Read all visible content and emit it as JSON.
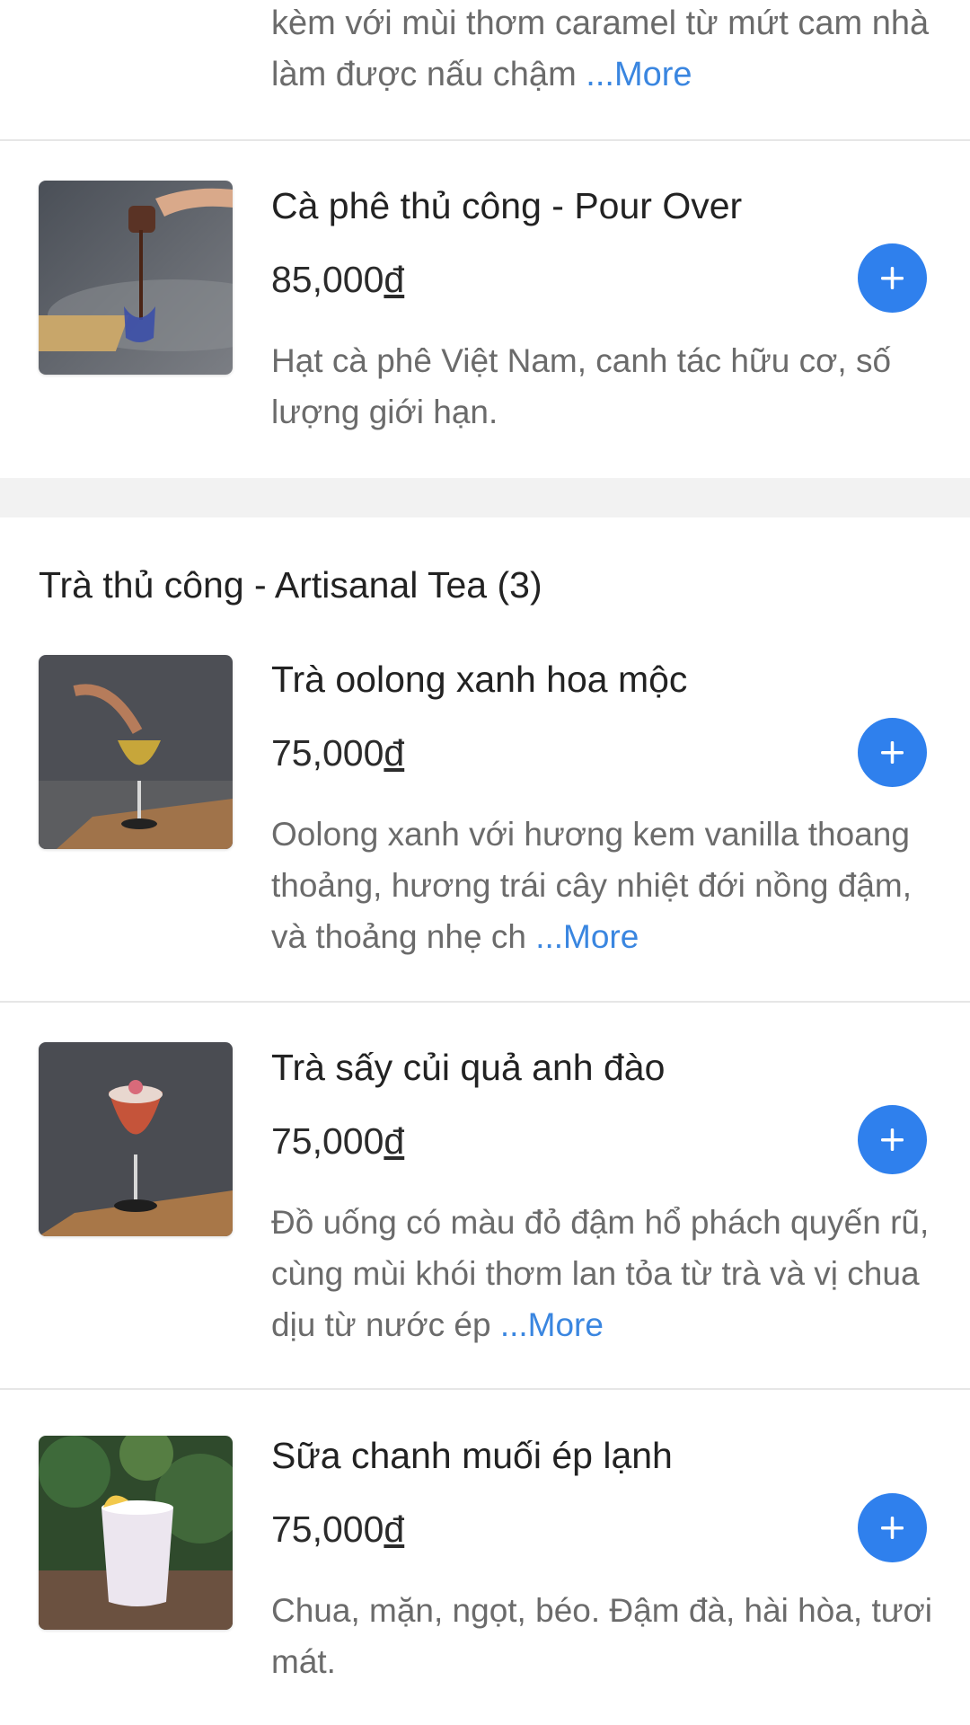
{
  "prev_item": {
    "desc_lines": [
      "kèm với mùi thơm caramel từ mứt cam nhà",
      "làm được nấu chậm "
    ],
    "more_label": "...More"
  },
  "items_coffee": [
    {
      "title": "Cà phê thủ công - Pour Over",
      "price_value": "85,000",
      "currency": "đ",
      "description": "Hạt cà phê Việt Nam, canh tác hữu cơ, số lượng giới hạn.",
      "more_label": "",
      "image_icon": "pour-over-coffee-image"
    }
  ],
  "section_tea": {
    "title": "Trà thủ công - Artisanal Tea (3)"
  },
  "items_tea": [
    {
      "title": "Trà oolong xanh hoa mộc",
      "price_value": "75,000",
      "currency": "đ",
      "description": "Oolong xanh với hương kem vanilla thoang thoảng, hương trái cây nhiệt đới nồng đậm, và thoảng nhẹ ch ",
      "more_label": "...More",
      "image_icon": "oolong-tea-glass-image"
    },
    {
      "title": "Trà sấy củi quả anh đào",
      "price_value": "75,000",
      "currency": "đ",
      "description": "Đồ uống có màu đỏ đậm hổ phách quyến rũ, cùng mùi khói thơm lan tỏa từ trà và vị chua dịu từ nước ép ",
      "more_label": "...More",
      "image_icon": "cherry-tea-glass-image"
    },
    {
      "title": "Sữa chanh muối ép lạnh",
      "price_value": "75,000",
      "currency": "đ",
      "description": "Chua, mặn, ngọt, béo. Đậm đà, hài hòa, tươi mát.",
      "more_label": "",
      "image_icon": "salted-lemon-milk-image"
    }
  ],
  "add_button_icon": "plus-icon",
  "colors": {
    "accent": "#2f80ed",
    "more_link": "#3a86e0",
    "text_secondary": "#6b6b6b",
    "divider": "#e6e6e6"
  }
}
